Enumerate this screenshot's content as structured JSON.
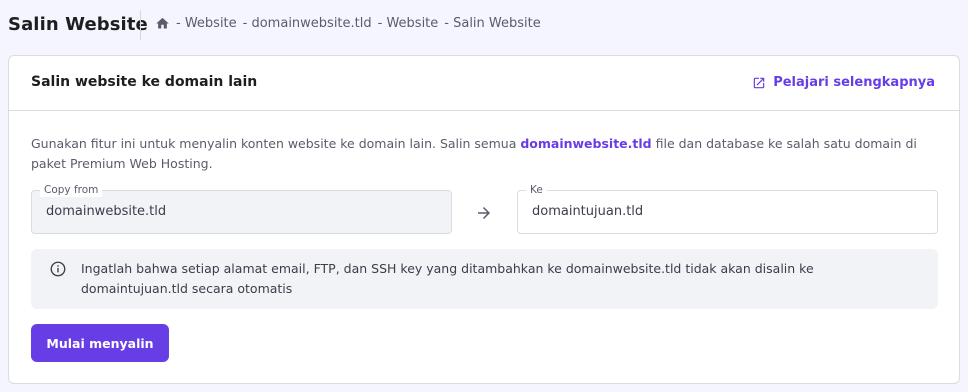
{
  "header": {
    "title": "Salin Website",
    "breadcrumb": [
      "- Website",
      "- domainwebsite.tld",
      "- Website",
      "- Salin Website"
    ]
  },
  "card": {
    "title": "Salin website ke domain lain",
    "learn_more": "Pelajari selengkapnya",
    "description_pre": "Gunakan fitur ini untuk menyalin konten website ke domain lain. Salin semua ",
    "description_domain": "domainwebsite.tld",
    "description_post": " file dan database ke salah satu domain di paket Premium Web Hosting.",
    "copy_from_label": "Copy from",
    "copy_from_value": "domainwebsite.tld",
    "to_label": "Ke",
    "to_value": "domaintujuan.tld",
    "alert": "Ingatlah bahwa setiap alamat email, FTP, dan SSH key yang ditambahkan ke domainwebsite.tld tidak akan disalin ke domaintujuan.tld secara otomatis",
    "start_button": "Mulai menyalin"
  },
  "icons": {
    "home": "home-icon",
    "external_link": "external-link-icon",
    "arrow": "arrow-right-icon",
    "info": "info-icon"
  },
  "colors": {
    "accent": "#673de6",
    "background": "#f4f5ff",
    "field_disabled": "#f2f3f6"
  }
}
